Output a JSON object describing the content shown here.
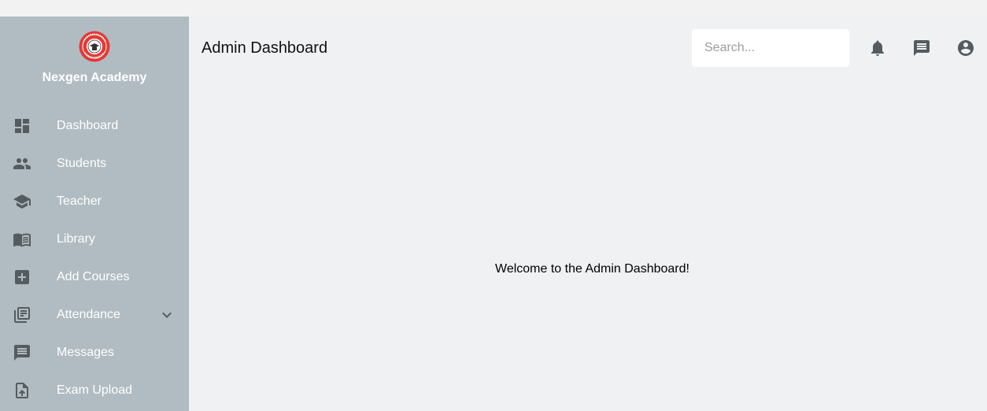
{
  "brand": {
    "name": "Nexgen Academy",
    "logo_icon": "academy-seal-logo"
  },
  "sidebar": {
    "items": [
      {
        "label": "Dashboard",
        "icon": "dashboard-icon"
      },
      {
        "label": "Students",
        "icon": "people-icon"
      },
      {
        "label": "Teacher",
        "icon": "school-icon"
      },
      {
        "label": "Library",
        "icon": "book-icon"
      },
      {
        "label": "Add Courses",
        "icon": "add-box-icon"
      },
      {
        "label": "Attendance",
        "icon": "library-books-icon",
        "expandable": true
      },
      {
        "label": "Messages",
        "icon": "message-icon"
      },
      {
        "label": "Exam Upload",
        "icon": "upload-file-icon"
      }
    ]
  },
  "header": {
    "title": "Admin Dashboard",
    "search_placeholder": "Search...",
    "icons": [
      "bell-icon",
      "chat-icon",
      "account-circle-icon"
    ]
  },
  "main": {
    "welcome": "Welcome to the Admin Dashboard!"
  },
  "colors": {
    "sidebar_bg": "#b0bcc2",
    "main_bg": "#f0f1f3",
    "icon": "#555c60",
    "logo_red": "#e53935"
  }
}
